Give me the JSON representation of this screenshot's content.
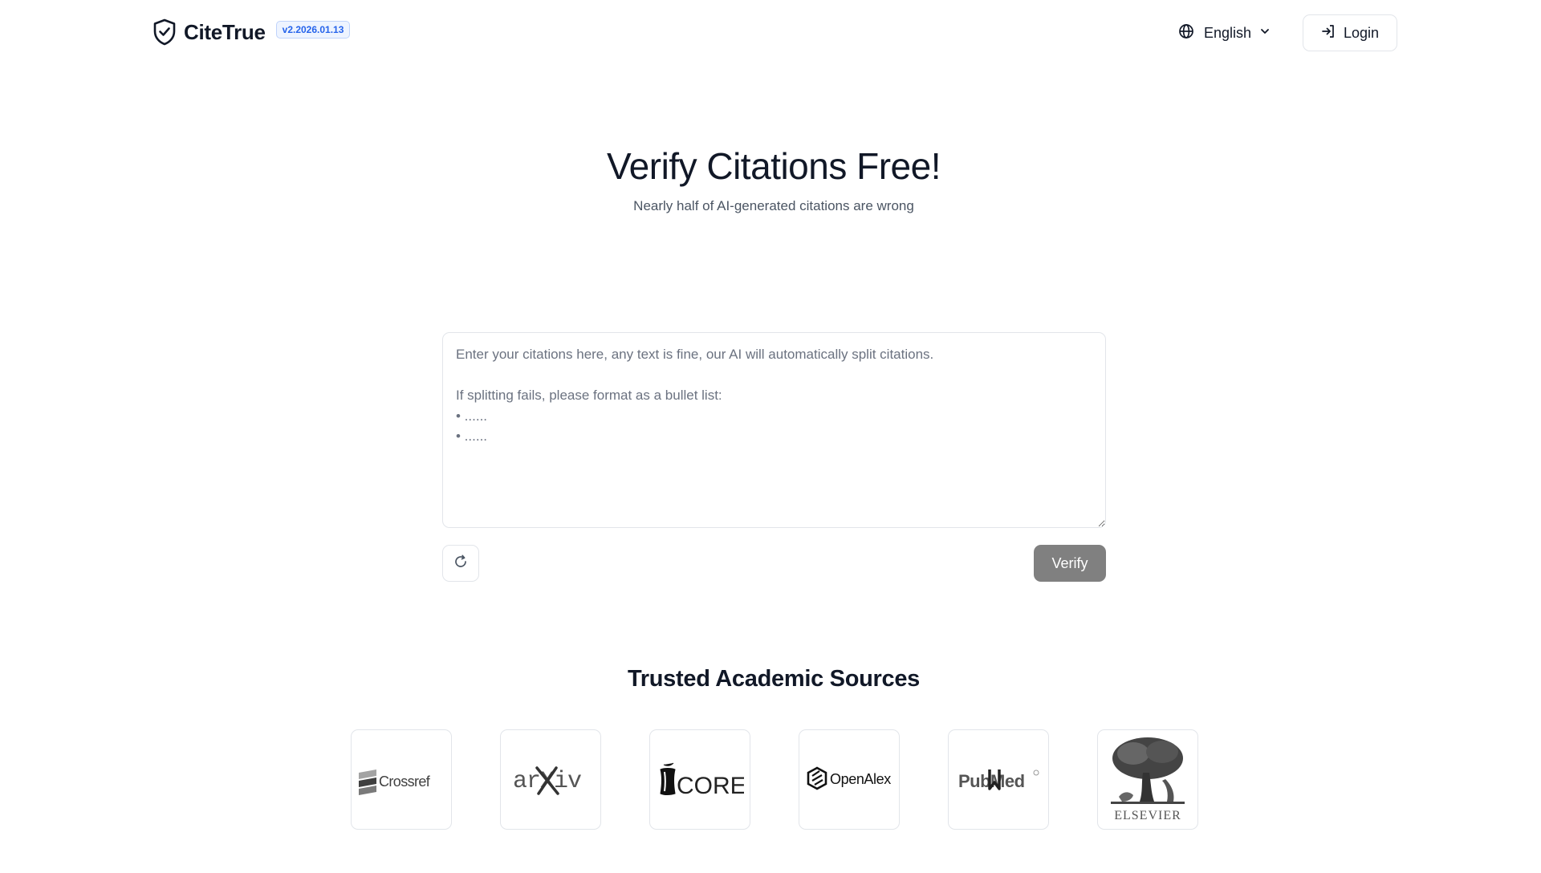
{
  "header": {
    "brand_name": "CiteTrue",
    "version": "v2.2026.01.13",
    "language": "English",
    "login_label": "Login"
  },
  "hero": {
    "title": "Verify Citations Free!",
    "subtitle": "Nearly half of AI-generated citations are wrong"
  },
  "input": {
    "placeholder": "Enter your citations here, any text is fine, our AI will automatically split citations.\n\nIf splitting fails, please format as a bullet list:\n• ......\n• ......",
    "value": ""
  },
  "actions": {
    "reset_icon": "refresh-icon",
    "verify_label": "Verify",
    "verify_color": "#808080"
  },
  "sources": {
    "title": "Trusted Academic Sources",
    "items": [
      {
        "name": "Crossref",
        "logo_text": "Crossref"
      },
      {
        "name": "arXiv",
        "logo_text": "arXiv"
      },
      {
        "name": "CORE",
        "logo_text": "CORE"
      },
      {
        "name": "OpenAlex",
        "logo_text": "OpenAlex"
      },
      {
        "name": "PubMed",
        "logo_text": "PubMed"
      },
      {
        "name": "Elsevier",
        "logo_text": "ELSEVIER"
      }
    ]
  },
  "colors": {
    "accent": "#2563eb",
    "border": "#e2e5ea",
    "text": "#111827",
    "muted": "#4b5563"
  }
}
